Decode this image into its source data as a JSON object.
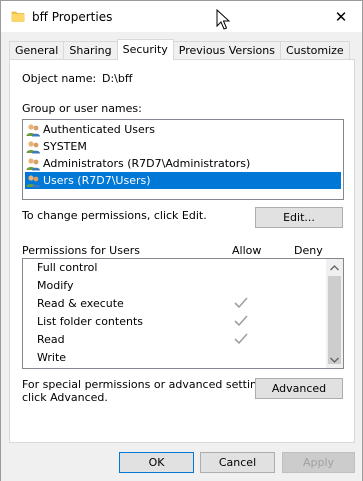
{
  "window": {
    "title": "bff Properties",
    "close_glyph": "✕",
    "icon": "folder-icon"
  },
  "tabs": [
    {
      "label": "General",
      "active": false
    },
    {
      "label": "Sharing",
      "active": false
    },
    {
      "label": "Security",
      "active": true
    },
    {
      "label": "Previous Versions",
      "active": false
    },
    {
      "label": "Customize",
      "active": false
    }
  ],
  "security": {
    "object_name_label": "Object name:",
    "object_name_value": "D:\\bff",
    "groups_label": "Group or user names:",
    "groups": [
      {
        "name": "Authenticated Users",
        "icon": "users-group-icon",
        "selected": false
      },
      {
        "name": "SYSTEM",
        "icon": "users-group-icon",
        "selected": false
      },
      {
        "name": "Administrators (R7D7\\Administrators)",
        "icon": "users-group-icon",
        "selected": false
      },
      {
        "name": "Users (R7D7\\Users)",
        "icon": "users-group-icon",
        "selected": true
      }
    ],
    "change_permissions_text": "To change permissions, click Edit.",
    "edit_button": "Edit...",
    "permissions_label": "Permissions for Users",
    "allow_header": "Allow",
    "deny_header": "Deny",
    "permissions": [
      {
        "name": "Full control",
        "allow": false,
        "deny": false
      },
      {
        "name": "Modify",
        "allow": false,
        "deny": false
      },
      {
        "name": "Read & execute",
        "allow": true,
        "deny": false
      },
      {
        "name": "List folder contents",
        "allow": true,
        "deny": false
      },
      {
        "name": "Read",
        "allow": true,
        "deny": false
      },
      {
        "name": "Write",
        "allow": false,
        "deny": false
      }
    ],
    "advanced_text_line1": "For special permissions or advanced settings,",
    "advanced_text_line2": "click Advanced.",
    "advanced_button": "Advanced"
  },
  "footer": {
    "ok": "OK",
    "cancel": "Cancel",
    "apply": "Apply"
  },
  "colors": {
    "selection": "#0078d7",
    "check_disabled": "#a0a0a0"
  }
}
